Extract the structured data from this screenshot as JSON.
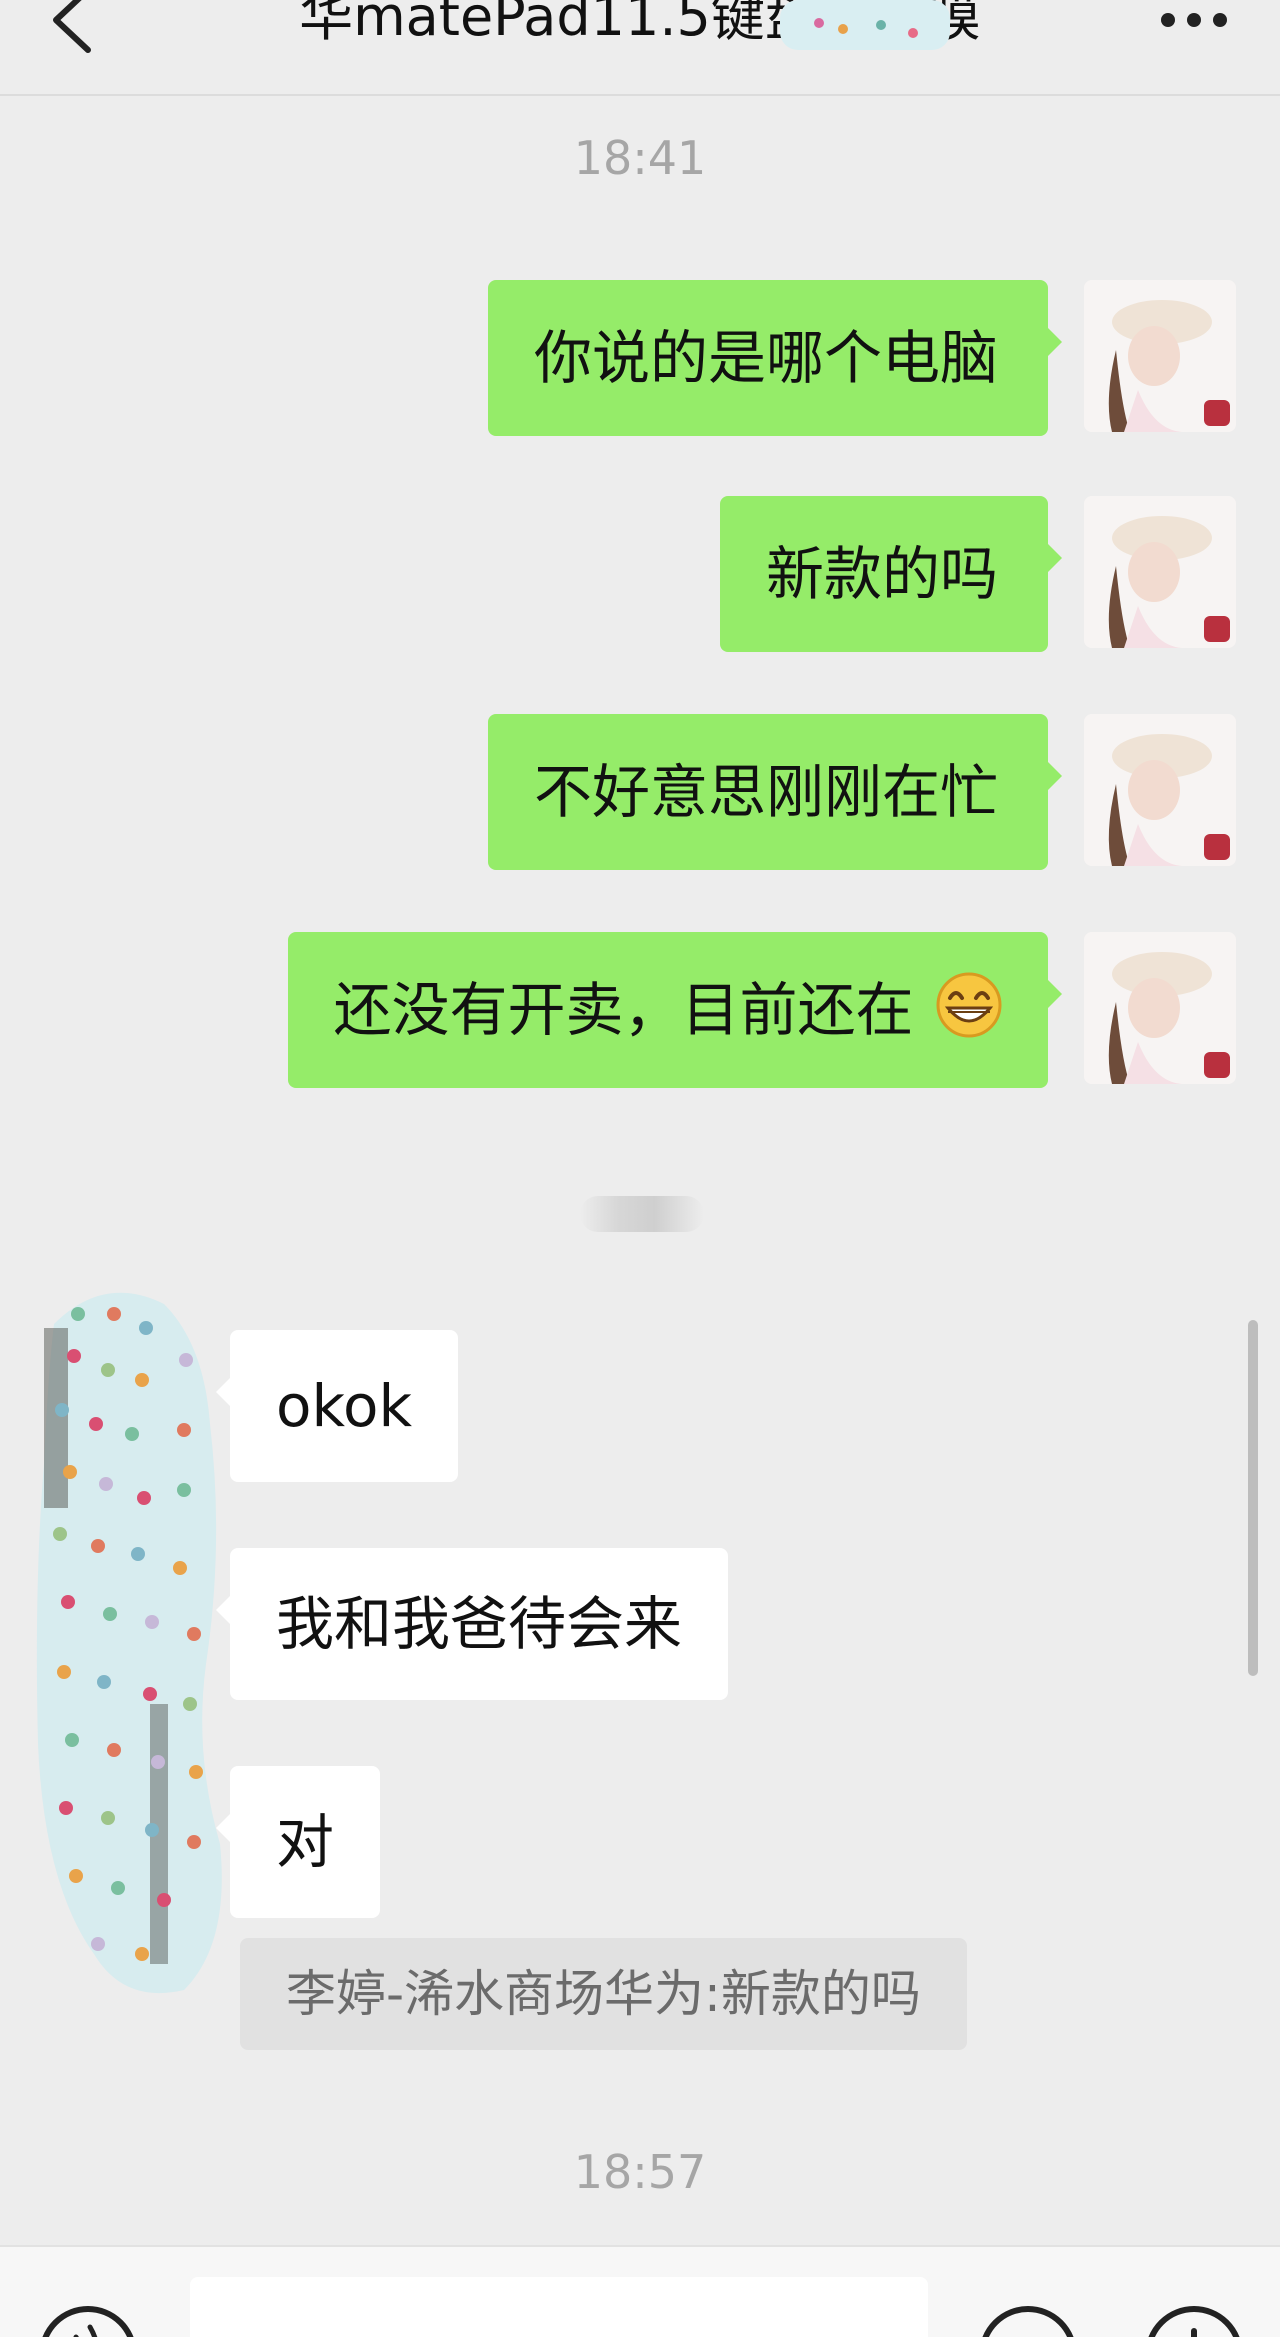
{
  "header": {
    "title": "华matePad11.5键盘保护膜",
    "back_icon": "chevron-left-icon",
    "more_icon": "more-dots-icon"
  },
  "timestamps": {
    "first": "18:41",
    "second": "18:57"
  },
  "messages_sent": [
    {
      "text": "你说的是哪个电脑"
    },
    {
      "text": "新款的吗"
    },
    {
      "text": "不好意思刚刚在忙"
    },
    {
      "text": "还没有开卖，目前还在"
    }
  ],
  "sent_emoji_icon": "grin-emoji-icon",
  "messages_received": [
    {
      "text": "okok"
    },
    {
      "text": "我和我爸待会来"
    },
    {
      "text": "对"
    }
  ],
  "quote": {
    "text": "李婷-浠水商场华为:新款的吗"
  },
  "colors": {
    "background": "#ededed",
    "sent_bubble": "#95ec69",
    "received_bubble": "#ffffff",
    "timestamp": "#a6a6a6"
  },
  "bottom_bar": {
    "voice_icon": "voice-icon",
    "emoji_icon": "emoji-icon",
    "plus_icon": "plus-icon"
  }
}
